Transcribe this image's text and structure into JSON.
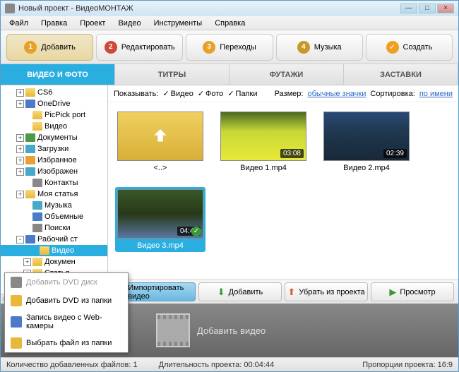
{
  "titlebar": {
    "title": "Новый проект - ВидеоМОНТАЖ"
  },
  "menu": {
    "file": "Файл",
    "edit": "Правка",
    "project": "Проект",
    "video": "Видео",
    "tools": "Инструменты",
    "help": "Справка"
  },
  "steps": {
    "s1": "Добавить",
    "s2": "Редактировать",
    "s3": "Переходы",
    "s4": "Музыка",
    "s5": "Создать"
  },
  "subtabs": {
    "t1": "ВИДЕО И ФОТО",
    "t2": "ТИТРЫ",
    "t3": "ФУТАЖИ",
    "t4": "ЗАСТАВКИ"
  },
  "tree": [
    {
      "pad": 2,
      "exp": "+",
      "ic": "tfolder",
      "label": "CS6"
    },
    {
      "pad": 2,
      "exp": "+",
      "ic": "tblue",
      "label": "OneDrive"
    },
    {
      "pad": 3,
      "exp": "",
      "ic": "tfolder",
      "label": "PicPick port"
    },
    {
      "pad": 3,
      "exp": "",
      "ic": "tfolder",
      "label": "Видео"
    },
    {
      "pad": 2,
      "exp": "+",
      "ic": "tgreen",
      "label": "Документы"
    },
    {
      "pad": 2,
      "exp": "+",
      "ic": "tcyan",
      "label": "Загрузки"
    },
    {
      "pad": 2,
      "exp": "+",
      "ic": "torange",
      "label": "Избранное"
    },
    {
      "pad": 2,
      "exp": "+",
      "ic": "tcyan",
      "label": "Изображен"
    },
    {
      "pad": 3,
      "exp": "",
      "ic": "tgray",
      "label": "Контакты"
    },
    {
      "pad": 2,
      "exp": "+",
      "ic": "tfolder",
      "label": "Моя статья"
    },
    {
      "pad": 3,
      "exp": "",
      "ic": "tcyan",
      "label": "Музыка"
    },
    {
      "pad": 3,
      "exp": "",
      "ic": "tblue",
      "label": "Объемные"
    },
    {
      "pad": 3,
      "exp": "",
      "ic": "tgray",
      "label": "Поиски"
    },
    {
      "pad": 2,
      "exp": "-",
      "ic": "tblue",
      "label": "Рабочий ст"
    },
    {
      "pad": 4,
      "exp": "",
      "ic": "tfolder",
      "label": "Видео",
      "sel": true
    },
    {
      "pad": 3,
      "exp": "+",
      "ic": "tfolder",
      "label": "Докумен"
    },
    {
      "pad": 3,
      "exp": "+",
      "ic": "tfolder",
      "label": "Статья"
    }
  ],
  "filter": {
    "show_label": "Показывать:",
    "video": "Видео",
    "photo": "Фото",
    "folders": "Папки",
    "size_label": "Размер:",
    "size_value": "обычные значки",
    "sort_label": "Сортировка:",
    "sort_value": "по имени"
  },
  "thumbs": {
    "up": "<..>",
    "v1": {
      "label": "Видео 1.mp4",
      "dur": "03:08"
    },
    "v2": {
      "label": "Видео 2.mp4",
      "dur": "02:39"
    },
    "v3": {
      "label": "Видео 3.mp4",
      "dur": "04:44"
    }
  },
  "actions": {
    "import": "Импортировать видео",
    "add": "Добавить",
    "remove": "Убрать из проекта",
    "preview": "Просмотр"
  },
  "popup": {
    "dvd_disc": "Добавить DVD диск",
    "dvd_folder": "Добавить DVD из папки",
    "webcam": "Запись видео с Web-камеры",
    "file": "Выбрать файл из папки"
  },
  "timeline": {
    "placeholder": "Добавить видео"
  },
  "status": {
    "files_label": "Количество добавленных файлов:",
    "files_count": "1",
    "duration_label": "Длительность проекта:",
    "duration_value": "00:04:44",
    "aspect_label": "Пропорции проекта:",
    "aspect_value": "16:9"
  }
}
